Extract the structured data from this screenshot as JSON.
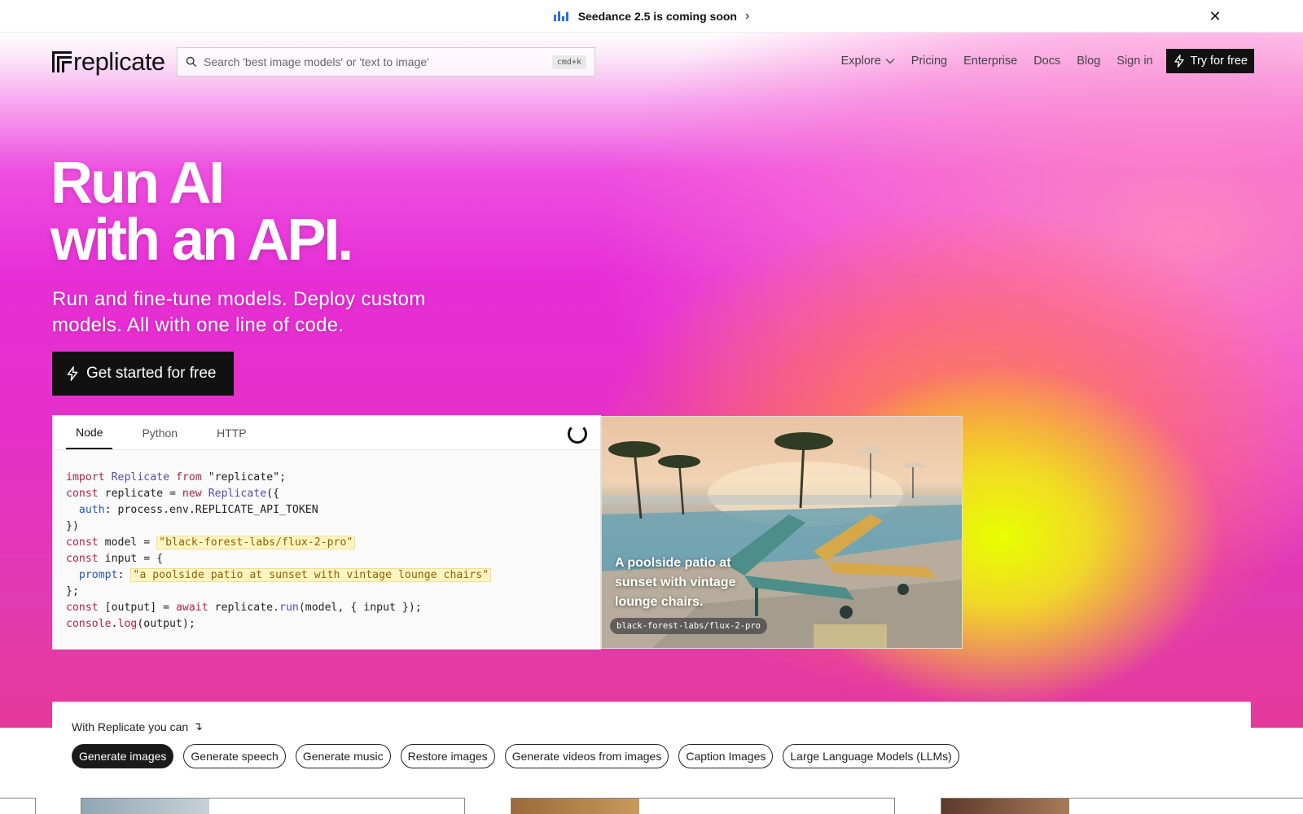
{
  "announcement": {
    "text": "Seedance 2.5 is coming soon",
    "icon": "bar-chart-icon",
    "chevron": "›",
    "close": "✕"
  },
  "nav": {
    "logo_text": "replicate",
    "search_placeholder": "Search 'best image models' or 'text to image'",
    "search_shortcut": "cmd+k",
    "links": {
      "explore": "Explore",
      "pricing": "Pricing",
      "enterprise": "Enterprise",
      "docs": "Docs",
      "blog": "Blog",
      "sign_in": "Sign in"
    },
    "try_button": "Try for free"
  },
  "hero": {
    "headline_line1": "Run AI",
    "headline_line2": "with an API.",
    "subhead": "Run and fine-tune models. Deploy custom models. All with one line of code.",
    "cta": "Get started for free"
  },
  "code_panel": {
    "tabs": [
      "Node",
      "Python",
      "HTTP"
    ],
    "active_tab": "Node",
    "model": "black-forest-labs/flux-2-pro",
    "prompt": "a poolside patio at sunset with vintage lounge chairs",
    "lines": {
      "l1_kw": "import",
      "l1_cls": "Replicate",
      "l1_from": "from",
      "l1_str": "\"replicate\"",
      "l1_end": ";",
      "l2_kw": "const",
      "l2_mid": " replicate = ",
      "l2_new": "new",
      "l2_cls": "Replicate",
      "l2_end": "({",
      "l3_prop": "auth",
      "l3_rest": ": process.env.REPLICATE_API_TOKEN",
      "l4": "})",
      "l5_kw": "const",
      "l5_mid": " model = ",
      "l5_str": "\"black-forest-labs/flux-2-pro\"",
      "l6_kw": "const",
      "l6_rest": " input = {",
      "l7_prop": "prompt",
      "l7_str": "\"a poolside patio at sunset with vintage lounge chairs\"",
      "l8": "};",
      "l9_kw": "const",
      "l9_mid": " [output] = ",
      "l9_await": "await",
      "l9_obj": " replicate.",
      "l9_fn": "run",
      "l9_end": "(model, { input });",
      "l10_obj": "console",
      "l10_dot": ".",
      "l10_fn": "log",
      "l10_end": "(output);"
    }
  },
  "preview": {
    "caption": "A poolside patio at sunset with vintage lounge chairs.",
    "model_tag": "black-forest-labs/flux-2-pro"
  },
  "capabilities": {
    "title": "With Replicate you can",
    "arrow": "↴",
    "pills": [
      "Generate images",
      "Generate speech",
      "Generate music",
      "Restore images",
      "Generate videos from images",
      "Caption Images",
      "Large Language Models (LLMs)"
    ],
    "active_pill": "Generate images"
  },
  "colors": {
    "accent_dark": "#111111",
    "hero_pink": "#e62ed6",
    "hero_yellow": "#e8ff00",
    "announce_icon_blue": "#2b6fd6"
  }
}
